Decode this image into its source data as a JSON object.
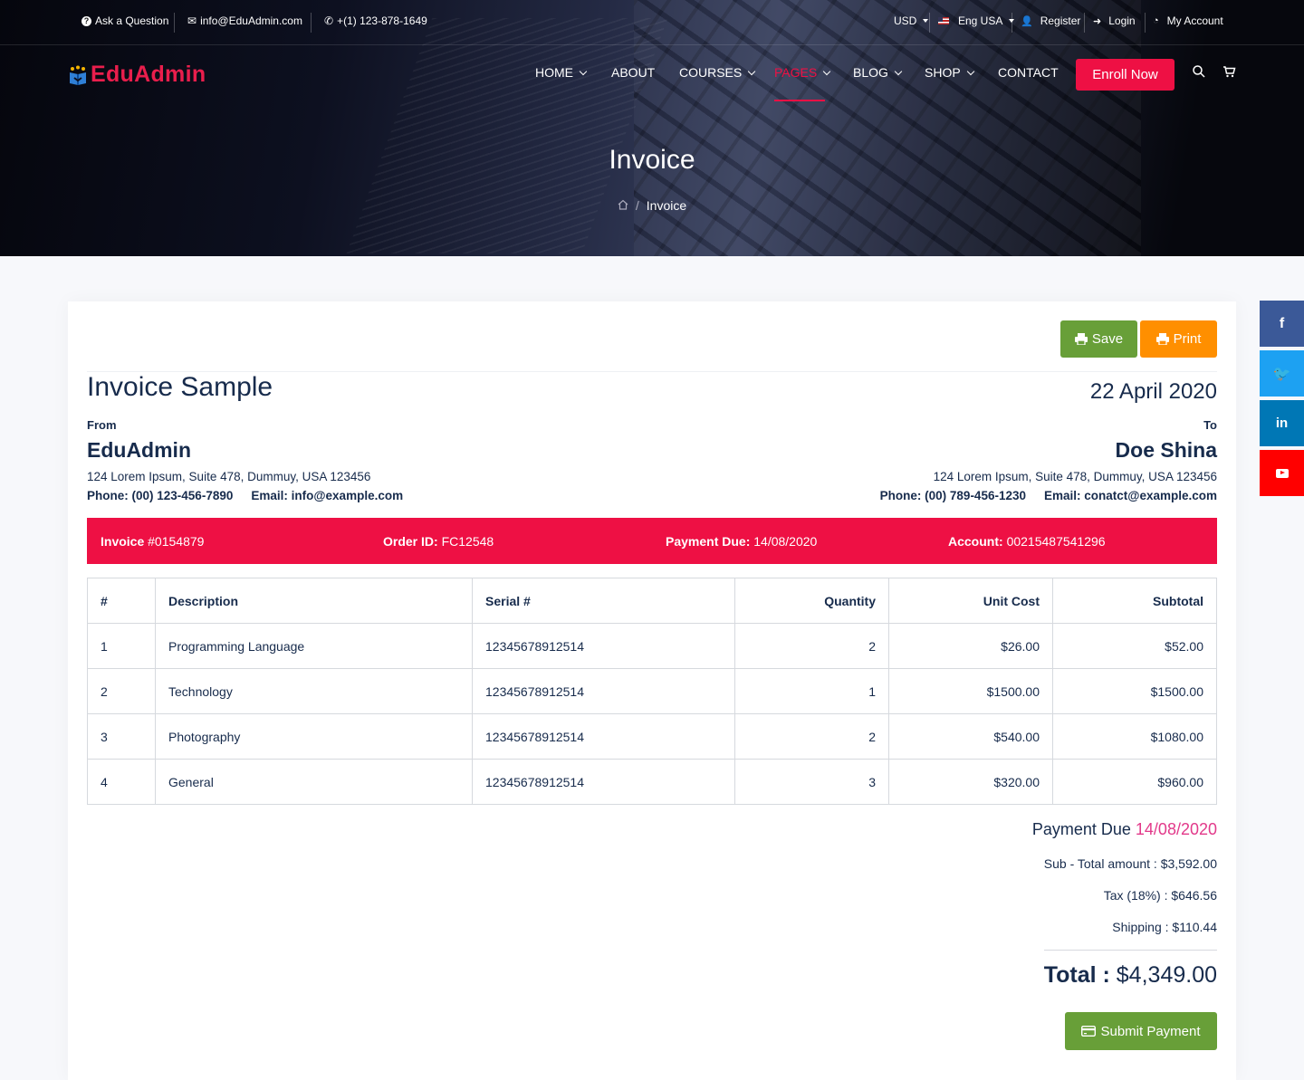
{
  "topbar": {
    "ask": "Ask a Question",
    "email": "info@EduAdmin.com",
    "phone": "+(1) 123-878-1649",
    "currency": "USD",
    "language": "Eng USA",
    "register": "Register",
    "login": "Login",
    "account": "My Account"
  },
  "brand": {
    "name": "EduAdmin",
    "color": "#e91e4c"
  },
  "nav": {
    "items": [
      "HOME",
      "ABOUT",
      "COURSES",
      "PAGES",
      "BLOG",
      "SHOP",
      "CONTACT"
    ],
    "active": "PAGES",
    "enroll": "Enroll Now"
  },
  "header": {
    "title": "Invoice",
    "breadcrumb_current": "Invoice"
  },
  "actions": {
    "save": "Save",
    "print": "Print",
    "submit": "Submit Payment"
  },
  "invoice": {
    "title": "Invoice Sample",
    "date": "22 April 2020",
    "from": {
      "label": "From",
      "name": "EduAdmin",
      "address": "124 Lorem Ipsum, Suite 478, Dummuy, USA 123456",
      "phone_label": "Phone:",
      "phone": "(00) 123-456-7890",
      "email_label": "Email:",
      "email": "info@example.com"
    },
    "to": {
      "label": "To",
      "name": "Doe Shina",
      "address": "124 Lorem Ipsum, Suite 478, Dummuy, USA 123456",
      "phone_label": "Phone:",
      "phone": "(00) 789-456-1230",
      "email_label": "Email:",
      "email": "conatct@example.com"
    },
    "band": {
      "invoice_label": "Invoice",
      "invoice_no": "#0154879",
      "order_label": "Order ID:",
      "order_id": "FC12548",
      "due_label": "Payment Due:",
      "due": "14/08/2020",
      "account_label": "Account:",
      "account": "00215487541296",
      "color": "#ee1044"
    },
    "table": {
      "headers": [
        "#",
        "Description",
        "Serial #",
        "Quantity",
        "Unit Cost",
        "Subtotal"
      ],
      "rows": [
        [
          "1",
          "Programming Language",
          "12345678912514",
          "2",
          "$26.00",
          "$52.00"
        ],
        [
          "2",
          "Technology",
          "12345678912514",
          "1",
          "$1500.00",
          "$1500.00"
        ],
        [
          "3",
          "Photography",
          "12345678912514",
          "2",
          "$540.00",
          "$1080.00"
        ],
        [
          "4",
          "General",
          "12345678912514",
          "3",
          "$320.00",
          "$960.00"
        ]
      ]
    },
    "summary": {
      "payment_due_label": "Payment Due",
      "payment_due": "14/08/2020",
      "subtotal": "Sub - Total amount : $3,592.00",
      "tax": "Tax (18%) : $646.56",
      "shipping": "Shipping : $110.44",
      "total_label": "Total :",
      "total": "$4,349.00"
    }
  },
  "social": [
    "facebook",
    "twitter",
    "linkedin",
    "youtube"
  ]
}
